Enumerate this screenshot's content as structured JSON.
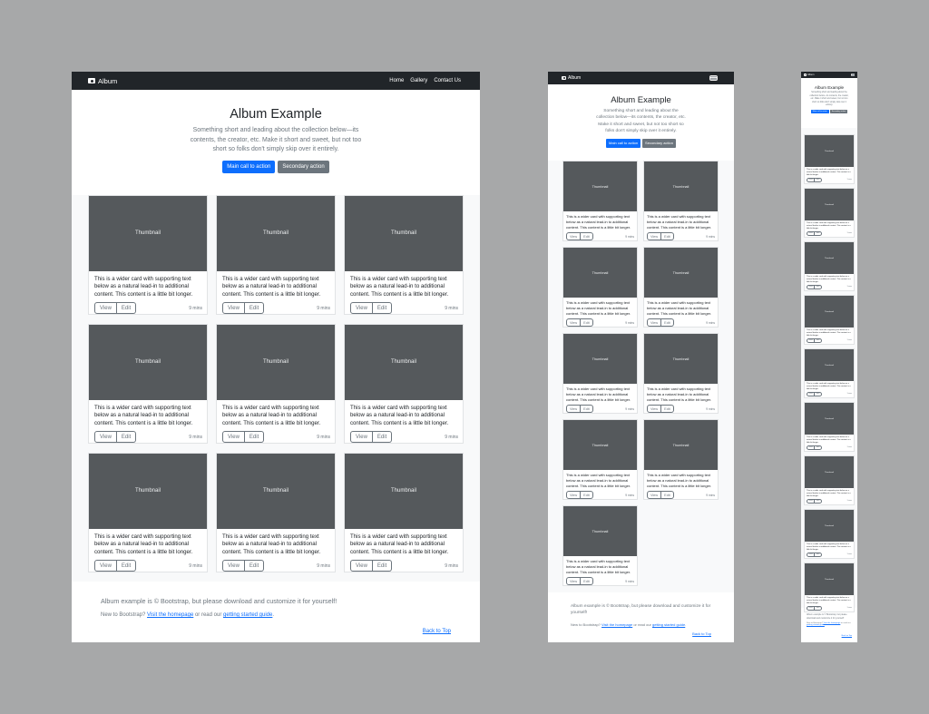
{
  "brand": "Album",
  "nav": {
    "links": [
      "Home",
      "Gallery",
      "Contact Us"
    ]
  },
  "hero": {
    "title": "Album Example",
    "lead": "Something short and leading about the collection below—its contents, the creator, etc. Make it short and sweet, but not too short so folks don't simply skip over it entirely.",
    "primary_button": "Main call to action",
    "secondary_button": "Secondary action"
  },
  "card": {
    "thumbnail_label": "Thumbnail",
    "text": "This is a wider card with supporting text below as a natural lead-in to additional content. This content is a little bit longer.",
    "view_label": "View",
    "edit_label": "Edit",
    "time": "9 mins"
  },
  "footer": {
    "line1": "Album example is © Bootstrap, but please download and customize it for yourself!",
    "line2_prefix": "New to Bootstrap? ",
    "homepage_link": "Visit the homepage",
    "line2_middle": " or read our ",
    "guide_link": "getting started guide",
    "line2_suffix": ".",
    "back_to_top": "Back to Top"
  },
  "layout": {
    "card_count_per_view": 9
  },
  "colors": {
    "navbar_bg": "#212529",
    "primary": "#0d6efd",
    "secondary": "#6c757d",
    "thumbnail_bg": "#55595c",
    "album_bg": "#f8f9fa",
    "canvas_bg": "#a7a8a9"
  }
}
